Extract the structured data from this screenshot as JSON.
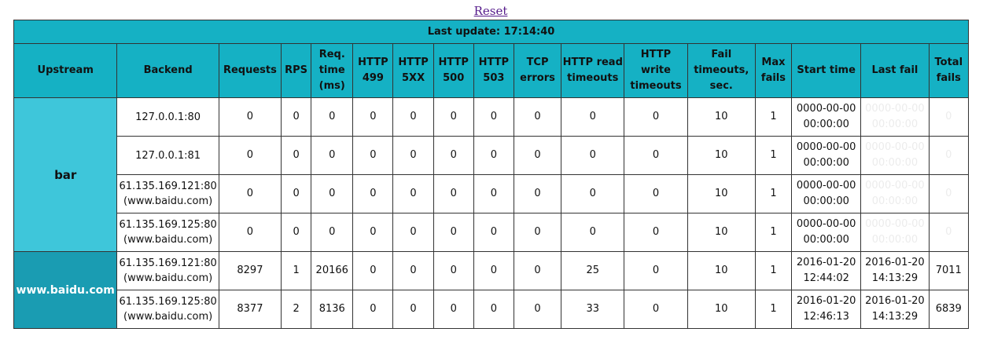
{
  "reset_label": "Reset",
  "title": "Last update: 17:14:40",
  "headers": [
    "Upstream",
    "Backend",
    "Requests",
    "RPS",
    "Req. time (ms)",
    "HTTP 499",
    "HTTP 5XX",
    "HTTP 500",
    "HTTP 503",
    "TCP errors",
    "HTTP read timeouts",
    "HTTP write timeouts",
    "Fail timeouts, sec.",
    "Max fails",
    "Start time",
    "Last fail",
    "Total fails"
  ],
  "upstreams": [
    {
      "name": "bar",
      "color": "#3ec6da",
      "rows": [
        {
          "backend": "127.0.0.1:80",
          "requests": "0",
          "rps": "0",
          "req_time": "0",
          "h499": "0",
          "h5xx": "0",
          "h500": "0",
          "h503": "0",
          "tcp": "0",
          "read_to": "0",
          "write_to": "0",
          "fail_to": "10",
          "max_fails": "1",
          "start_time": "0000-00-00 00:00:00",
          "last_fail": "0000-00-00 00:00:00",
          "total_fails": "0"
        },
        {
          "backend": "127.0.0.1:81",
          "requests": "0",
          "rps": "0",
          "req_time": "0",
          "h499": "0",
          "h5xx": "0",
          "h500": "0",
          "h503": "0",
          "tcp": "0",
          "read_to": "0",
          "write_to": "0",
          "fail_to": "10",
          "max_fails": "1",
          "start_time": "0000-00-00 00:00:00",
          "last_fail": "0000-00-00 00:00:00",
          "total_fails": "0"
        },
        {
          "backend": "61.135.169.121:80 (www.baidu.com)",
          "requests": "0",
          "rps": "0",
          "req_time": "0",
          "h499": "0",
          "h5xx": "0",
          "h500": "0",
          "h503": "0",
          "tcp": "0",
          "read_to": "0",
          "write_to": "0",
          "fail_to": "10",
          "max_fails": "1",
          "start_time": "0000-00-00 00:00:00",
          "last_fail": "0000-00-00 00:00:00",
          "total_fails": "0"
        },
        {
          "backend": "61.135.169.125:80 (www.baidu.com)",
          "requests": "0",
          "rps": "0",
          "req_time": "0",
          "h499": "0",
          "h5xx": "0",
          "h500": "0",
          "h503": "0",
          "tcp": "0",
          "read_to": "0",
          "write_to": "0",
          "fail_to": "10",
          "max_fails": "1",
          "start_time": "0000-00-00 00:00:00",
          "last_fail": "0000-00-00 00:00:00",
          "total_fails": "0"
        }
      ]
    },
    {
      "name": "www.baidu.com",
      "color": "#1a9cb2",
      "rows": [
        {
          "backend": "61.135.169.121:80 (www.baidu.com)",
          "requests": "8297",
          "rps": "1",
          "req_time": "20166",
          "h499": "0",
          "h5xx": "0",
          "h500": "0",
          "h503": "0",
          "tcp": "0",
          "read_to": "25",
          "write_to": "0",
          "fail_to": "10",
          "max_fails": "1",
          "start_time": "2016-01-20 12:44:02",
          "last_fail": "2016-01-20 14:13:29",
          "total_fails": "7011"
        },
        {
          "backend": "61.135.169.125:80 (www.baidu.com)",
          "requests": "8377",
          "rps": "2",
          "req_time": "8136",
          "h499": "0",
          "h5xx": "0",
          "h500": "0",
          "h503": "0",
          "tcp": "0",
          "read_to": "33",
          "write_to": "0",
          "fail_to": "10",
          "max_fails": "1",
          "start_time": "2016-01-20 12:46:13",
          "last_fail": "2016-01-20 14:13:29",
          "total_fails": "6839"
        }
      ]
    }
  ]
}
